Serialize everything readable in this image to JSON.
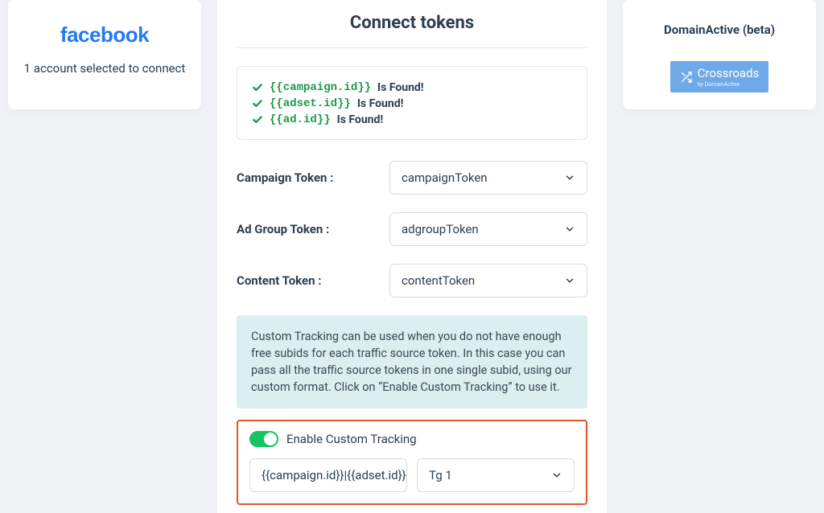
{
  "left": {
    "logo_text": "facebook",
    "subtitle": "1 account selected to connect"
  },
  "right": {
    "title": "DomainActive (beta)",
    "badge_main": "Crossroads",
    "badge_sub": "by DomainActive"
  },
  "center": {
    "title": "Connect tokens",
    "found_items": [
      {
        "token": "{{campaign.id}}",
        "status": "Is Found!"
      },
      {
        "token": "{{adset.id}}",
        "status": "Is Found!"
      },
      {
        "token": "{{ad.id}}",
        "status": "Is Found!"
      }
    ],
    "rows": {
      "campaign_label": "Campaign Token :",
      "campaign_value": "campaignToken",
      "adgroup_label": "Ad Group Token :",
      "adgroup_value": "adgroupToken",
      "content_label": "Content Token :",
      "content_value": "contentToken"
    },
    "info_text": "Custom Tracking can be used when you do not have enough free subids for each traffic source token. In this case you can pass all the traffic source tokens in one single subid, using our custom format. Click on “Enable Custom Tracking” to use it.",
    "toggle_label": "Enable Custom Tracking",
    "custom_value": "{{campaign.id}}|{{adset.id}}|{{ad.id}",
    "custom_select": "Tg 1"
  }
}
